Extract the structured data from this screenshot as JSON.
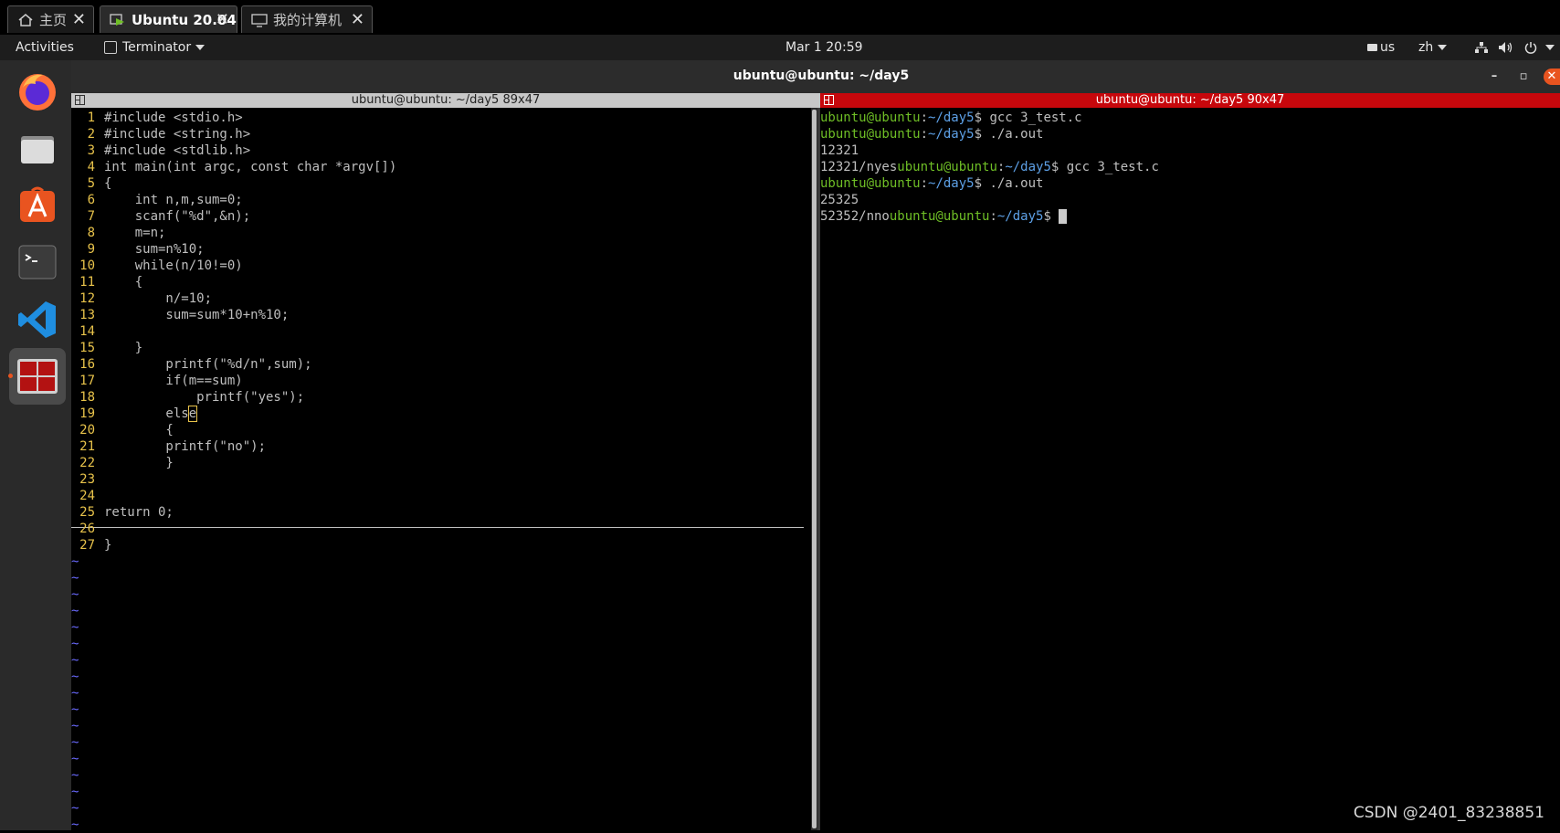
{
  "vmware_tabs": [
    {
      "label": "主页",
      "icon": "home-icon",
      "active": false
    },
    {
      "label": "Ubuntu 20.04",
      "icon": "vm-icon",
      "active": true
    },
    {
      "label": "我的计算机",
      "icon": "monitor-icon",
      "active": false
    }
  ],
  "topbar": {
    "activities": "Activities",
    "app_menu": "Terminator",
    "clock": "Mar 1  20:59",
    "keyboard_layout": "us",
    "input_method": "zh"
  },
  "dock": [
    {
      "name": "firefox-icon",
      "active": false
    },
    {
      "name": "files-icon",
      "active": false
    },
    {
      "name": "software-center-icon",
      "active": false
    },
    {
      "name": "terminal-icon",
      "active": false
    },
    {
      "name": "vscode-icon",
      "active": false
    },
    {
      "name": "terminator-icon",
      "active": true
    }
  ],
  "window": {
    "title": "ubuntu@ubuntu: ~/day5"
  },
  "left_pane": {
    "title": "ubuntu@ubuntu: ~/day5 89x47",
    "code_lines": [
      "#include <stdio.h>",
      "#include <string.h>",
      "#include <stdlib.h>",
      "int main(int argc, const char *argv[])",
      "{",
      "    int n,m,sum=0;",
      "    scanf(\"%d\",&n);",
      "    m=n;",
      "    sum=n%10;",
      "    while(n/10!=0)",
      "    {",
      "        n/=10;",
      "        sum=sum*10+n%10;",
      "",
      "    }",
      "        printf(\"%d/n\",sum);",
      "        if(m==sum)",
      "            printf(\"yes\");",
      "        else",
      "        {",
      "        printf(\"no\");",
      "        }",
      "",
      "",
      "return 0;",
      "",
      "}"
    ],
    "tilde_count": 17,
    "tilde_char": "~"
  },
  "right_pane": {
    "title": "ubuntu@ubuntu: ~/day5 90x47",
    "prompt_user": "ubuntu@ubuntu",
    "prompt_colon": ":",
    "prompt_path": "~/day5",
    "prompt_dollar": "$ ",
    "lines": [
      {
        "prefix": "",
        "prompt": true,
        "text": "gcc 3_test.c"
      },
      {
        "prefix": "",
        "prompt": true,
        "text": "./a.out"
      },
      {
        "prefix": "12321",
        "prompt": false,
        "text": ""
      },
      {
        "prefix": "12321/nyes",
        "prompt": true,
        "text": "gcc 3_test.c"
      },
      {
        "prefix": "",
        "prompt": true,
        "text": "./a.out"
      },
      {
        "prefix": "25325",
        "prompt": false,
        "text": ""
      },
      {
        "prefix": "52352/nno",
        "prompt": true,
        "text": ""
      }
    ]
  },
  "watermark": "CSDN @2401_83238851",
  "colors": {
    "active_pane_title": "#c7070c",
    "prompt_user": "#6fbf26",
    "prompt_path": "#5da0e6",
    "line_number": "#e8c34b",
    "ubuntu_accent": "#e95420"
  }
}
